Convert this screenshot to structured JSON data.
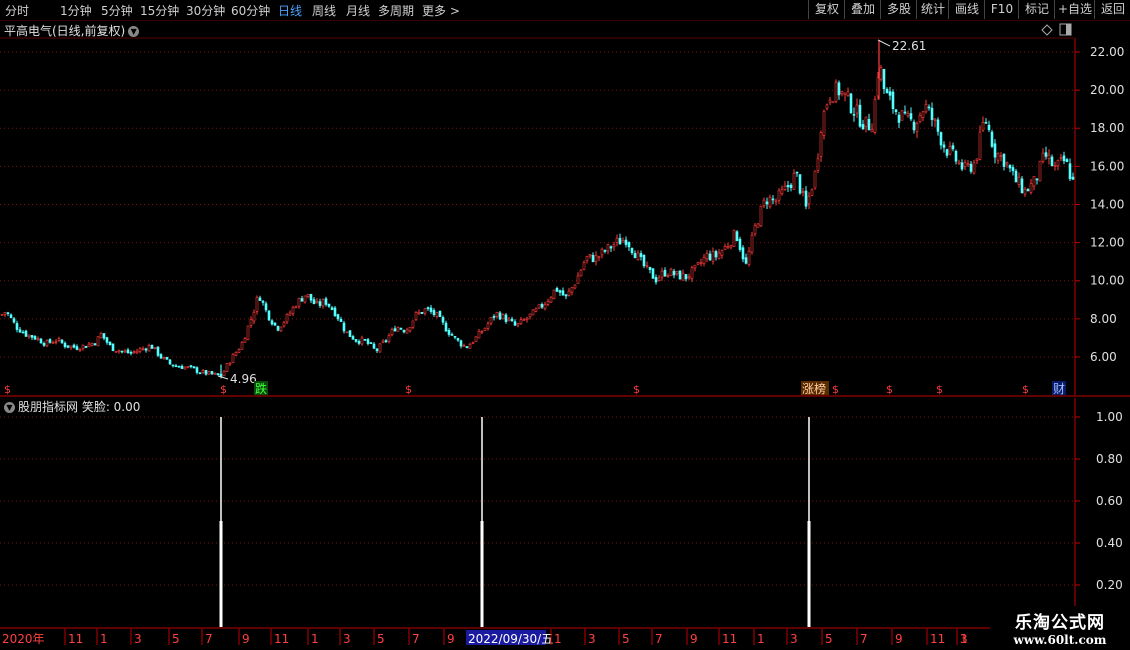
{
  "toolbar": {
    "periods": [
      "分时",
      "1分钟",
      "5分钟",
      "15分钟",
      "30分钟",
      "60分钟",
      "日线",
      "周线",
      "月线",
      "多周期",
      "更多 >"
    ],
    "active_period": "日线",
    "buttons": [
      "复权",
      "叠加",
      "多股",
      "统计",
      "画线",
      "F10",
      "标记",
      "+自选",
      "返回"
    ]
  },
  "chart_title": "平高电气(日线,前复权)",
  "indicator_title": "股朋指标网 笑脸: 0.00",
  "price_axis_labels": [
    "22.00",
    "20.00",
    "18.00",
    "16.00",
    "14.00",
    "12.00",
    "10.00",
    "8.00",
    "6.00"
  ],
  "indicator_axis_labels": [
    "1.00",
    "0.80",
    "0.60",
    "0.40",
    "0.20"
  ],
  "annotations": {
    "high_label": "22.61",
    "low_label": "4.96"
  },
  "event_markers": {
    "fall": "跌",
    "limit_up": "涨榜",
    "finance": "财",
    "dollar": "$"
  },
  "time_axis": {
    "labels": [
      "2020年",
      "11",
      "1",
      "3",
      "5",
      "7",
      "9",
      "11",
      "1",
      "3",
      "5",
      "7",
      "9",
      "2022/09/30/五",
      "1",
      "3",
      "5",
      "7",
      "9",
      "11",
      "1",
      "3",
      "5",
      "7",
      "9",
      "11",
      "1",
      "3"
    ],
    "highlight": "2022/09/30/五"
  },
  "brand": {
    "name": "乐淘公式网",
    "url": "www.60lt.com"
  },
  "colors": {
    "up": "#ff3c3c",
    "down": "#54ffff",
    "grid": "#7a1010",
    "axis": "#c00000",
    "highlight_bg": "#1a1aa0"
  },
  "chart_data": {
    "type": "candlestick",
    "y_range": [
      4.5,
      23.0
    ],
    "close_path": [
      [
        0,
        8.2
      ],
      [
        5,
        8.4
      ],
      [
        15,
        7.6
      ],
      [
        25,
        7.2
      ],
      [
        35,
        7.0
      ],
      [
        45,
        6.7
      ],
      [
        55,
        6.9
      ],
      [
        65,
        6.6
      ],
      [
        75,
        6.5
      ],
      [
        85,
        6.6
      ],
      [
        95,
        6.8
      ],
      [
        100,
        7.2
      ],
      [
        110,
        6.5
      ],
      [
        120,
        6.3
      ],
      [
        130,
        6.2
      ],
      [
        140,
        6.4
      ],
      [
        150,
        6.6
      ],
      [
        160,
        6.0
      ],
      [
        170,
        5.6
      ],
      [
        180,
        5.5
      ],
      [
        190,
        5.4
      ],
      [
        200,
        5.2
      ],
      [
        210,
        5.1
      ],
      [
        220,
        5.0
      ],
      [
        230,
        5.9
      ],
      [
        240,
        6.6
      ],
      [
        250,
        8.0
      ],
      [
        258,
        9.3
      ],
      [
        266,
        8.3
      ],
      [
        276,
        7.5
      ],
      [
        285,
        8.0
      ],
      [
        295,
        8.8
      ],
      [
        305,
        9.3
      ],
      [
        315,
        8.7
      ],
      [
        325,
        8.9
      ],
      [
        335,
        8.3
      ],
      [
        345,
        7.3
      ],
      [
        355,
        6.9
      ],
      [
        365,
        6.8
      ],
      [
        375,
        6.3
      ],
      [
        385,
        6.9
      ],
      [
        395,
        7.6
      ],
      [
        405,
        7.4
      ],
      [
        415,
        8.2
      ],
      [
        425,
        8.5
      ],
      [
        435,
        8.2
      ],
      [
        445,
        7.5
      ],
      [
        455,
        6.9
      ],
      [
        465,
        6.5
      ],
      [
        475,
        7.0
      ],
      [
        485,
        7.6
      ],
      [
        495,
        8.3
      ],
      [
        505,
        8.0
      ],
      [
        515,
        7.6
      ],
      [
        525,
        8.0
      ],
      [
        535,
        8.4
      ],
      [
        545,
        8.9
      ],
      [
        555,
        9.6
      ],
      [
        565,
        9.1
      ],
      [
        575,
        10.0
      ],
      [
        585,
        11.2
      ],
      [
        595,
        11.2
      ],
      [
        605,
        11.6
      ],
      [
        615,
        12.0
      ],
      [
        625,
        12.2
      ],
      [
        635,
        11.4
      ],
      [
        645,
        10.6
      ],
      [
        655,
        10.1
      ],
      [
        665,
        10.5
      ],
      [
        675,
        10.3
      ],
      [
        685,
        10.2
      ],
      [
        695,
        10.6
      ],
      [
        705,
        11.3
      ],
      [
        715,
        11.3
      ],
      [
        725,
        11.8
      ],
      [
        735,
        12.5
      ],
      [
        745,
        10.8
      ],
      [
        755,
        13.0
      ],
      [
        765,
        14.3
      ],
      [
        775,
        14.2
      ],
      [
        785,
        14.8
      ],
      [
        795,
        15.6
      ],
      [
        805,
        13.8
      ],
      [
        815,
        15.8
      ],
      [
        820,
        18.2
      ],
      [
        828,
        19.8
      ],
      [
        838,
        20.0
      ],
      [
        848,
        19.4
      ],
      [
        858,
        18.6
      ],
      [
        866,
        18.1
      ],
      [
        872,
        18.4
      ],
      [
        878,
        21.5
      ],
      [
        884,
        19.8
      ],
      [
        894,
        19.0
      ],
      [
        904,
        18.4
      ],
      [
        914,
        18.3
      ],
      [
        924,
        19.2
      ],
      [
        934,
        18.2
      ],
      [
        944,
        17.0
      ],
      [
        954,
        16.4
      ],
      [
        964,
        15.8
      ],
      [
        974,
        16.2
      ],
      [
        984,
        18.6
      ],
      [
        994,
        16.8
      ],
      [
        1004,
        16.3
      ],
      [
        1014,
        15.3
      ],
      [
        1024,
        14.7
      ],
      [
        1034,
        15.2
      ],
      [
        1044,
        16.6
      ],
      [
        1054,
        15.9
      ],
      [
        1064,
        16.3
      ],
      [
        1072,
        15.2
      ]
    ]
  }
}
